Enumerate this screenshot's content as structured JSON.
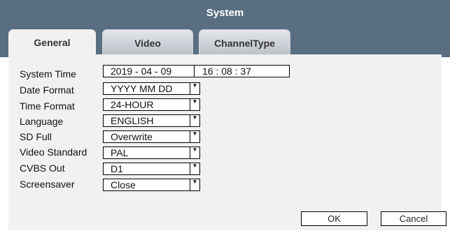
{
  "window": {
    "title": "System"
  },
  "tabs": [
    {
      "label": "General",
      "active": true
    },
    {
      "label": "Video",
      "active": false
    },
    {
      "label": "ChannelType",
      "active": false
    }
  ],
  "form": {
    "system_time": {
      "label": "System Time",
      "date": "2019 - 04 - 09",
      "time": "16 : 08 : 37"
    },
    "date_format": {
      "label": "Date Format",
      "value": "YYYY MM DD"
    },
    "time_format": {
      "label": "Time Format",
      "value": "24-HOUR"
    },
    "language": {
      "label": "Language",
      "value": "ENGLISH"
    },
    "sd_full": {
      "label": "SD Full",
      "value": "Overwrite"
    },
    "video_standard": {
      "label": "Video Standard",
      "value": "PAL"
    },
    "cvbs_out": {
      "label": "CVBS Out",
      "value": "D1"
    },
    "screensaver": {
      "label": "Screensaver",
      "value": "Close"
    }
  },
  "buttons": {
    "ok": "OK",
    "cancel": "Cancel"
  },
  "icons": {
    "dropdown_arrow": "caret-down-icon"
  },
  "colors": {
    "header_bg": "#5a6e82",
    "content_bg": "#f1f1f1"
  }
}
